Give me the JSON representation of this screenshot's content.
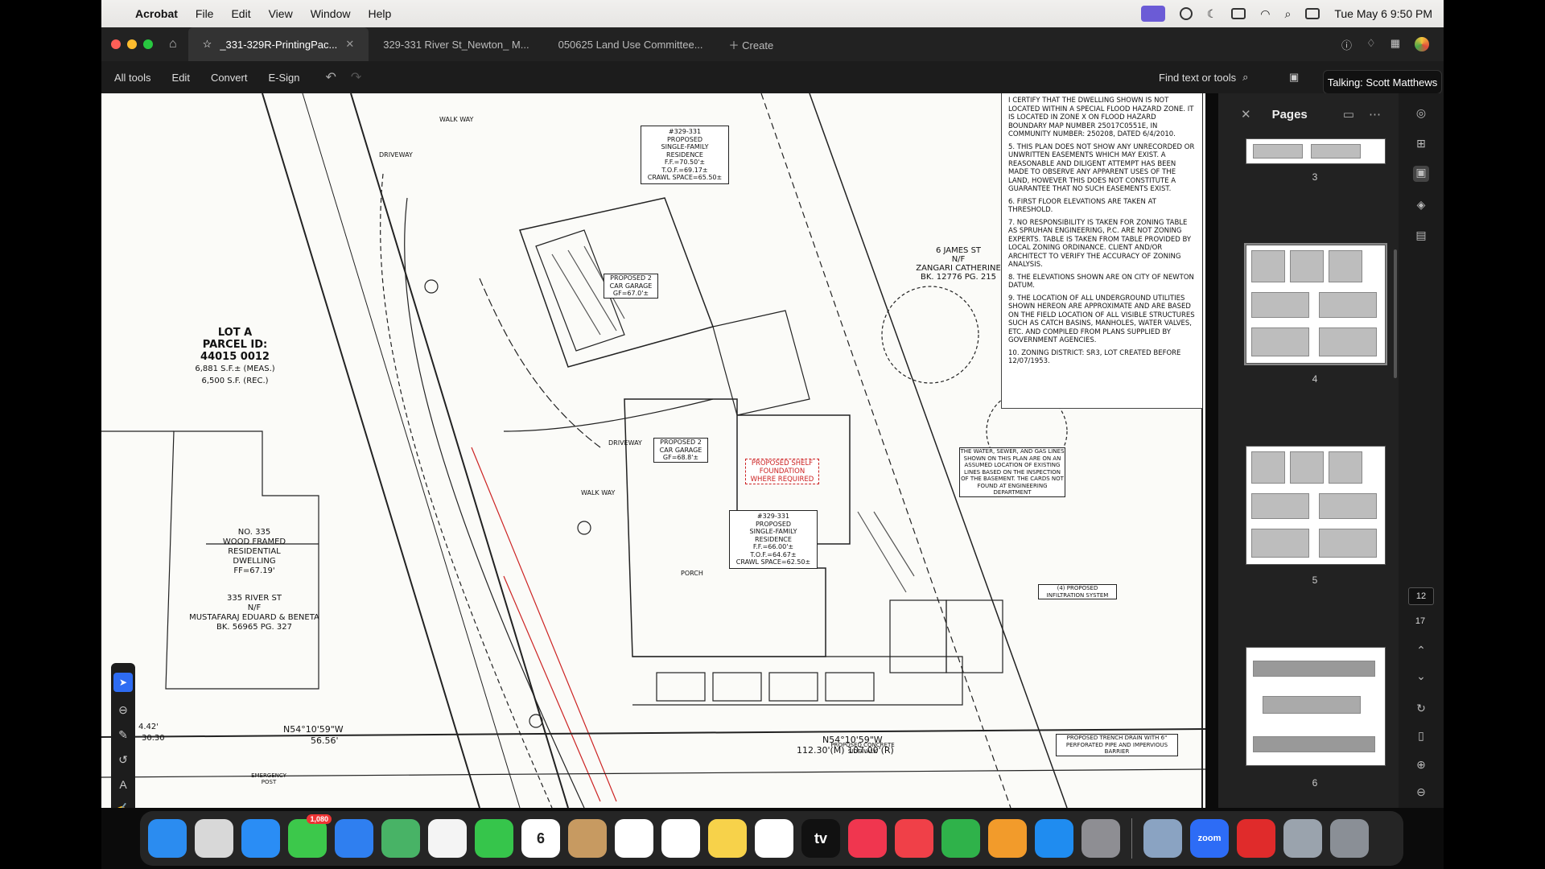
{
  "menubar": {
    "app": "Acrobat",
    "items": [
      "File",
      "Edit",
      "View",
      "Window",
      "Help"
    ],
    "clock": "Tue May 6  9:50 PM"
  },
  "tabs": [
    {
      "label": "_331-329R-PrintingPac..."
    },
    {
      "label": "329-331 River St_Newton_ M..."
    },
    {
      "label": "050625 Land Use Committee..."
    }
  ],
  "tabs_create": "Create",
  "toolbar": {
    "all_tools": "All tools",
    "edit": "Edit",
    "convert": "Convert",
    "esign": "E-Sign",
    "find": "Find text or tools"
  },
  "tooltip": "Talking: Scott Matthews",
  "pages_panel": {
    "title": "Pages",
    "page_numbers": [
      "3",
      "4",
      "5",
      "6"
    ]
  },
  "right_rail": {
    "current_page": "12",
    "total_pages": "17"
  },
  "drawing": {
    "notes": [
      "I CERTIFY THAT THE DWELLING SHOWN IS NOT LOCATED WITHIN A SPECIAL FLOOD HAZARD ZONE. IT IS LOCATED IN ZONE X ON FLOOD HAZARD BOUNDARY MAP NUMBER 25017C0551E, IN COMMUNITY NUMBER: 250208, DATED 6/4/2010.",
      "5. THIS PLAN DOES NOT SHOW ANY UNRECORDED OR UNWRITTEN EASEMENTS WHICH MAY EXIST. A REASONABLE AND DILIGENT ATTEMPT HAS BEEN MADE TO OBSERVE ANY APPARENT USES OF THE LAND, HOWEVER THIS DOES NOT CONSTITUTE A GUARANTEE THAT NO SUCH EASEMENTS EXIST.",
      "6. FIRST FLOOR ELEVATIONS ARE TAKEN AT THRESHOLD.",
      "7. NO RESPONSIBILITY IS TAKEN FOR ZONING TABLE AS SPRUHAN ENGINEERING, P.C. ARE NOT ZONING EXPERTS. TABLE IS TAKEN FROM TABLE PROVIDED BY LOCAL ZONING ORDINANCE. CLIENT AND/OR ARCHITECT TO VERIFY THE ACCURACY OF ZONING ANALYSIS.",
      "8. THE ELEVATIONS SHOWN ARE ON CITY OF NEWTON DATUM.",
      "9. THE LOCATION OF ALL UNDERGROUND UTILITIES SHOWN HEREON ARE APPROXIMATE AND ARE BASED ON THE FIELD LOCATION OF ALL VISIBLE STRUCTURES SUCH AS CATCH BASINS, MANHOLES, WATER VALVES, ETC. AND COMPILED FROM PLANS SUPPLIED BY GOVERNMENT AGENCIES.",
      "10. ZONING DISTRICT: SR3, LOT CREATED BEFORE 12/07/1953."
    ],
    "lot_a": [
      "LOT A",
      "PARCEL ID:",
      "44015 0012",
      "6,881 S.F.± (MEAS.)",
      "6,500 S.F. (REC.)"
    ],
    "no_335": [
      "NO. 335",
      "WOOD FRAMED",
      "RESIDENTIAL",
      "DWELLING",
      "FF=67.19'"
    ],
    "river_st": [
      "335 RIVER ST",
      "N/F",
      "MUSTAFARAJ EDUARD & BENETA",
      "BK. 56965 PG. 327"
    ],
    "james_st": [
      "6 JAMES ST",
      "N/F",
      "ZANGARI CATHERINE",
      "BK. 12776 PG. 215"
    ],
    "res_north": [
      "#329-331",
      "PROPOSED",
      "SINGLE-FAMILY",
      "RESIDENCE",
      "F.F.=70.50'±",
      "T.O.F.=69.17±",
      "CRAWL SPACE=65.50±"
    ],
    "res_south": [
      "#329-331",
      "PROPOSED",
      "SINGLE-FAMILY",
      "RESIDENCE",
      "F.F.=66.00'±",
      "T.O.F.=64.67±",
      "CRAWL SPACE=62.50±"
    ],
    "garage_north": [
      "PROPOSED 2",
      "CAR GARAGE",
      "GF=67.0'±"
    ],
    "garage_south": [
      "PROPOSED 2",
      "CAR GARAGE",
      "GF=68.8'±"
    ],
    "shelf": [
      "PROPOSED SHELF",
      "FOUNDATION",
      "WHERE REQUIRED"
    ],
    "bearing_left": "N54°10'59\"W",
    "dist_left": "56.56'",
    "bearing_right": "N54°10'59\"W",
    "dist_right": "112.30'(M) 107.00'(R)",
    "water_note": "THE WATER, SEWER, AND GAS LINES SHOWN ON THIS PLAN ARE ON AN ASSUMED LOCATION OF EXISTING LINES BASED ON THE INSPECTION OF THE BASEMENT. THE CARDS NOT FOUND AT ENGINEERING DEPARTMENT",
    "infiltration": "(4) PROPOSED INFILTRATION SYSTEM",
    "trench": "PROPOSED TRENCH DRAIN WITH 6\" PERFORATED PIPE AND IMPERVIOUS BARRIER",
    "misc": [
      "WALK WAY",
      "DRIVEWAY",
      "PORCH",
      "PROPOSED CONCRETE SIDEWALK",
      "EMERGENCY POST",
      "4.42'",
      "30.30",
      "WALK WAY",
      "DRIVEWAY"
    ]
  },
  "dock": [
    {
      "name": "finder-icon",
      "color": "#2b8cf0"
    },
    {
      "name": "launchpad-icon",
      "color": "#d8d8d8"
    },
    {
      "name": "safari-icon",
      "color": "#2a8df5"
    },
    {
      "name": "messages-icon",
      "color": "#3cc84b",
      "badge": "1,080"
    },
    {
      "name": "mail-icon",
      "color": "#2f7ff0"
    },
    {
      "name": "maps-icon",
      "color": "#48b366"
    },
    {
      "name": "photos-icon",
      "color": "#f4f4f4"
    },
    {
      "name": "facetime-icon",
      "color": "#36c54b"
    },
    {
      "name": "calendar-icon",
      "color": "#ffffff",
      "text": "6"
    },
    {
      "name": "contacts-icon",
      "color": "#c79a61"
    },
    {
      "name": "reminders-icon",
      "color": "#ffffff"
    },
    {
      "name": "chrome-icon",
      "color": "#ffffff"
    },
    {
      "name": "notes-icon",
      "color": "#f7d24a"
    },
    {
      "name": "freeform-icon",
      "color": "#ffffff"
    },
    {
      "name": "tv-icon",
      "color": "#111111",
      "text": "tv"
    },
    {
      "name": "music-icon",
      "color": "#f0364f"
    },
    {
      "name": "news-icon",
      "color": "#f04048"
    },
    {
      "name": "numbers-icon",
      "color": "#2fb24a"
    },
    {
      "name": "pages-icon",
      "color": "#f29b2b"
    },
    {
      "name": "appstore-icon",
      "color": "#1f8cf0"
    },
    {
      "name": "settings-icon",
      "color": "#8e8e93"
    },
    {
      "name": "preview-icon",
      "color": "#8aa3c2"
    },
    {
      "name": "zoom-icon",
      "color": "#2d6cf6",
      "text": "zoom"
    },
    {
      "name": "acrobat-icon",
      "color": "#e02b2b"
    },
    {
      "name": "downloads-icon",
      "color": "#9aa3ad"
    },
    {
      "name": "trash-icon",
      "color": "#8a8f96"
    }
  ]
}
